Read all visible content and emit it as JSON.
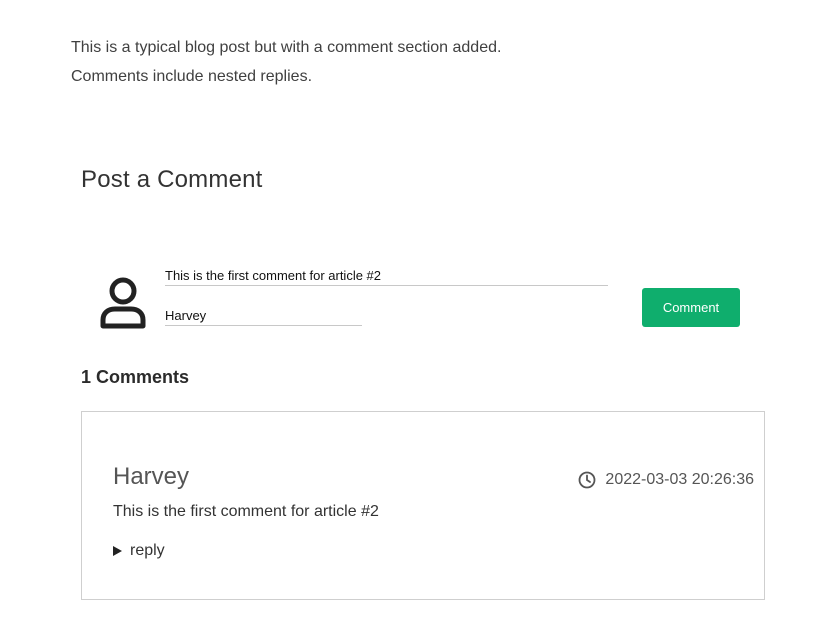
{
  "article": {
    "intro_line1": "This is a typical blog post but with a comment section added.",
    "intro_line2": "Comments include nested replies."
  },
  "comment_form": {
    "heading": "Post a Comment",
    "avatar_icon": "user-icon",
    "comment_value": "This is the first comment for article #2",
    "name_value": "Harvey",
    "submit_label": "Comment",
    "button_color": "#0fae6d"
  },
  "comments": {
    "count": "1",
    "count_label": "Comments",
    "items": [
      {
        "author": "Harvey",
        "timestamp_icon": "clock-icon",
        "timestamp": "2022-03-03 20:26:36",
        "text": "This is the first comment for article #2",
        "reply_label": "reply"
      }
    ]
  }
}
